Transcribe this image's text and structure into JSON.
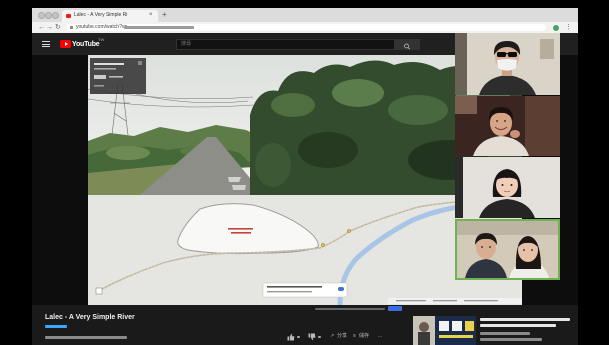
{
  "browser": {
    "tab_title": "Lalec - A Very Simple Ri",
    "tab_close": "×",
    "new_tab": "+",
    "nav_back": "←",
    "nav_forward": "→",
    "nav_reload": "↻",
    "url": "youtube.com/watch?v=",
    "menu": "⋮"
  },
  "youtube": {
    "logo_text": "YouTube",
    "region": "TW",
    "search_placeholder": "搜尋"
  },
  "video": {
    "title": "Lalec - A Very Simple River",
    "actions": {
      "share_glyph": "↗",
      "share": "分享",
      "save_glyph": "≡",
      "save": "儲存",
      "more": "..."
    }
  },
  "colors": {
    "youtube_red": "#ff0000",
    "page_dark": "#1a1a1a",
    "active_speaker_border": "#6fb34f",
    "river": "#a9c5e6"
  },
  "icons": [
    "hamburger-icon",
    "youtube-logo-icon",
    "search-icon",
    "like-icon",
    "dislike-icon",
    "share-icon",
    "save-icon",
    "more-icon",
    "lock-icon"
  ]
}
